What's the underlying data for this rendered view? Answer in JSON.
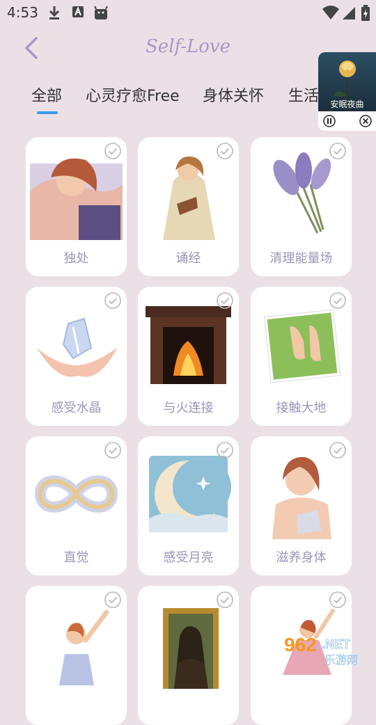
{
  "status": {
    "time": "4:53",
    "icons": [
      "download-icon",
      "a-icon",
      "android-icon",
      "wifi-icon",
      "signal-icon",
      "battery-icon"
    ]
  },
  "header": {
    "title": "Self-Love",
    "back_icon": "chevron-left-icon"
  },
  "tabs": [
    "全部",
    "心灵疗愈Free",
    "身体关怀",
    "生活"
  ],
  "player": {
    "caption": "安眠夜曲",
    "pause_icon": "pause-icon",
    "close_icon": "close-icon"
  },
  "cards": [
    {
      "label": "独处"
    },
    {
      "label": "诵经"
    },
    {
      "label": "清理能量场"
    },
    {
      "label": "感受水晶"
    },
    {
      "label": "与火连接"
    },
    {
      "label": "接触大地"
    },
    {
      "label": "直觉"
    },
    {
      "label": "感受月亮"
    },
    {
      "label": "滋养身体"
    },
    {
      "label": ""
    },
    {
      "label": ""
    },
    {
      "label": ""
    }
  ],
  "watermark": {
    "brand": "962",
    "domain": ".NET",
    "site": "乐游网"
  },
  "colors": {
    "background": "#ece0e7",
    "accent": "#a697c7",
    "tab_indicator": "#3a9ae8",
    "label": "#9d95b8"
  }
}
